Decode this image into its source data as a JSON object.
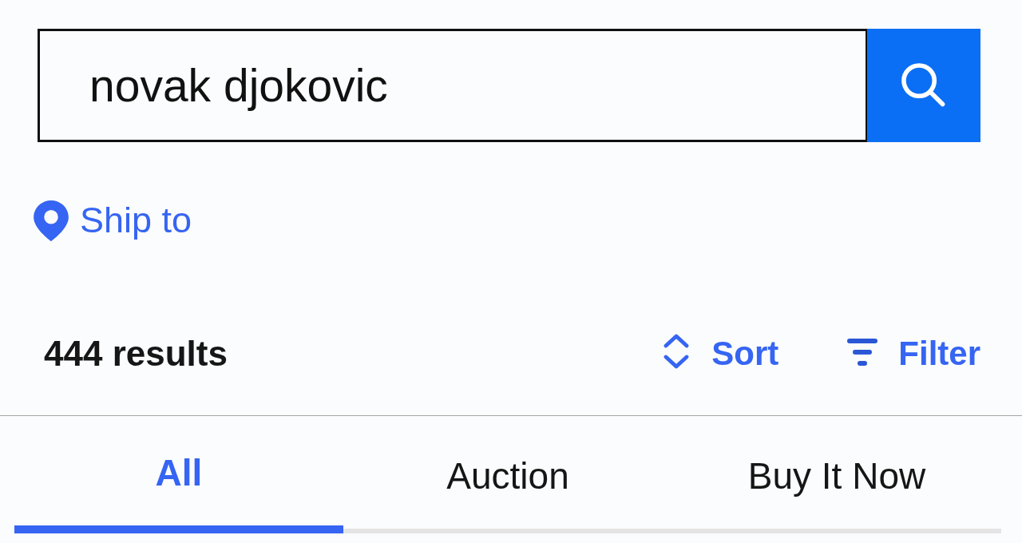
{
  "search": {
    "value": "novak djokovic"
  },
  "ship_to": {
    "label": "Ship to"
  },
  "results": {
    "count": "444 results"
  },
  "actions": [
    {
      "kind": "sort",
      "label": "Sort"
    },
    {
      "kind": "filter",
      "label": "Filter"
    }
  ],
  "tabs": [
    {
      "label": "All",
      "selected": true
    },
    {
      "label": "Auction",
      "selected": false
    },
    {
      "label": "Buy It Now",
      "selected": false
    }
  ]
}
